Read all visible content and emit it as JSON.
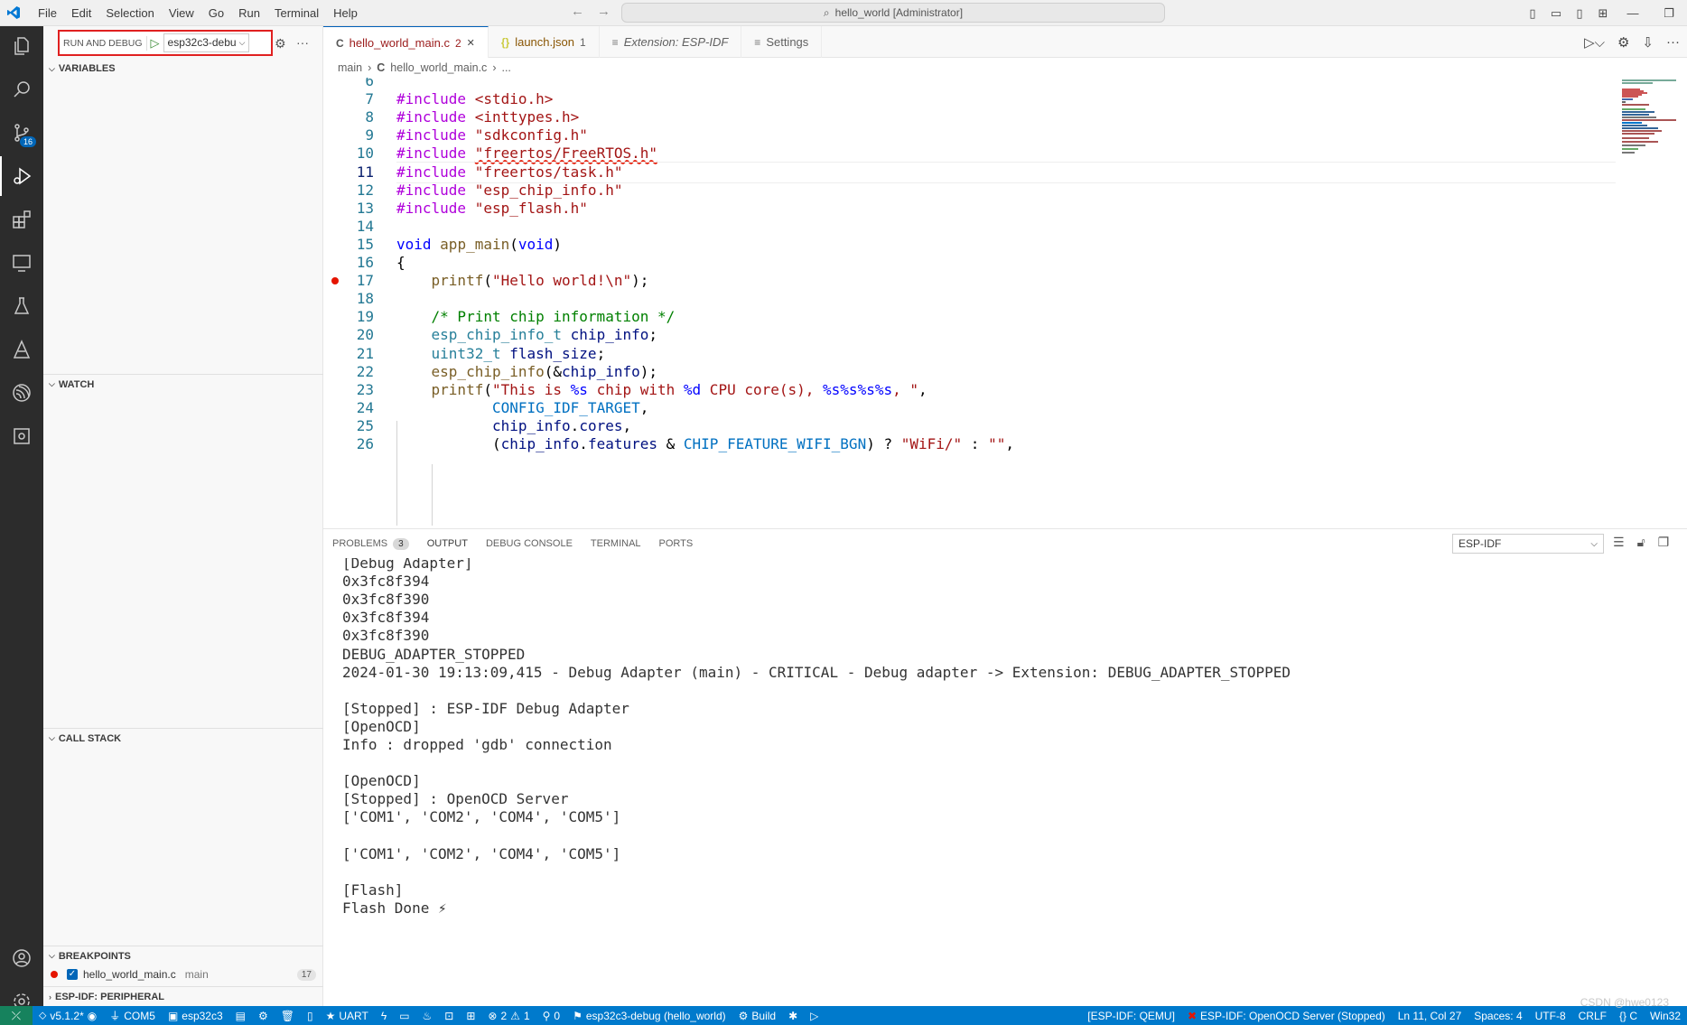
{
  "menu": [
    "File",
    "Edit",
    "Selection",
    "View",
    "Go",
    "Run",
    "Terminal",
    "Help"
  ],
  "command_center": "hello_world [Administrator]",
  "run_debug": {
    "label": "RUN AND DEBUG",
    "config": "esp32c3-debu"
  },
  "sections": {
    "variables": "VARIABLES",
    "watch": "WATCH",
    "call_stack": "CALL STACK",
    "breakpoints": "BREAKPOINTS",
    "peripheral": "ESP-IDF: PERIPHERAL"
  },
  "breakpoint": {
    "file": "hello_world_main.c",
    "function": "main",
    "line": "17"
  },
  "activity_badge": "16",
  "tabs": [
    {
      "icon": "C",
      "label": "hello_world_main.c",
      "count": "2"
    },
    {
      "icon": "{}",
      "label": "launch.json",
      "count": "1"
    },
    {
      "icon": "≡",
      "label": "Extension: ESP-IDF",
      "count": ""
    },
    {
      "icon": "≡",
      "label": "Settings",
      "count": ""
    }
  ],
  "breadcrumb": {
    "folder": "main",
    "file_icon": "C",
    "file": "hello_world_main.c",
    "more": "..."
  },
  "code": [
    {
      "n": "6",
      "t": []
    },
    {
      "n": "7",
      "t": [
        [
          "kw",
          "#include"
        ],
        [
          "plain",
          " "
        ],
        [
          "str",
          "<stdio.h>"
        ]
      ]
    },
    {
      "n": "8",
      "t": [
        [
          "kw",
          "#include"
        ],
        [
          "plain",
          " "
        ],
        [
          "str",
          "<inttypes.h>"
        ]
      ]
    },
    {
      "n": "9",
      "t": [
        [
          "kw",
          "#include"
        ],
        [
          "plain",
          " "
        ],
        [
          "str",
          "\"sdkconfig.h\""
        ]
      ]
    },
    {
      "n": "10",
      "t": [
        [
          "kw",
          "#include"
        ],
        [
          "plain",
          " "
        ],
        [
          "str",
          "\"freertos/FreeRTOS.h\""
        ]
      ]
    },
    {
      "n": "11",
      "t": [
        [
          "kw",
          "#include"
        ],
        [
          "plain",
          " "
        ],
        [
          "str",
          "\"freertos/task.h\""
        ]
      ]
    },
    {
      "n": "12",
      "t": [
        [
          "kw",
          "#include"
        ],
        [
          "plain",
          " "
        ],
        [
          "str",
          "\"esp_chip_info.h\""
        ]
      ]
    },
    {
      "n": "13",
      "t": [
        [
          "kw",
          "#include"
        ],
        [
          "plain",
          " "
        ],
        [
          "str",
          "\"esp_flash.h\""
        ]
      ]
    },
    {
      "n": "14",
      "t": []
    },
    {
      "n": "15",
      "t": [
        [
          "blu",
          "void"
        ],
        [
          "plain",
          " "
        ],
        [
          "fnc",
          "app_main"
        ],
        [
          "plain",
          "("
        ],
        [
          "blu",
          "void"
        ],
        [
          "plain",
          ")"
        ]
      ]
    },
    {
      "n": "16",
      "t": [
        [
          "plain",
          "{"
        ]
      ]
    },
    {
      "n": "17",
      "t": [
        [
          "plain",
          "    "
        ],
        [
          "fnc",
          "printf"
        ],
        [
          "plain",
          "("
        ],
        [
          "str",
          "\"Hello world!\\n\""
        ],
        [
          "plain",
          ");"
        ]
      ]
    },
    {
      "n": "18",
      "t": []
    },
    {
      "n": "19",
      "t": [
        [
          "plain",
          "    "
        ],
        [
          "cm",
          "/* Print chip information */"
        ]
      ]
    },
    {
      "n": "20",
      "t": [
        [
          "plain",
          "    "
        ],
        [
          "ty",
          "esp_chip_info_t"
        ],
        [
          "plain",
          " "
        ],
        [
          "var",
          "chip_info"
        ],
        [
          "plain",
          ";"
        ]
      ]
    },
    {
      "n": "21",
      "t": [
        [
          "plain",
          "    "
        ],
        [
          "ty",
          "uint32_t"
        ],
        [
          "plain",
          " "
        ],
        [
          "var",
          "flash_size"
        ],
        [
          "plain",
          ";"
        ]
      ]
    },
    {
      "n": "22",
      "t": [
        [
          "plain",
          "    "
        ],
        [
          "fnc",
          "esp_chip_info"
        ],
        [
          "plain",
          "(&"
        ],
        [
          "var",
          "chip_info"
        ],
        [
          "plain",
          ");"
        ]
      ]
    },
    {
      "n": "23",
      "t": [
        [
          "plain",
          "    "
        ],
        [
          "fnc",
          "printf"
        ],
        [
          "plain",
          "("
        ],
        [
          "str",
          "\"This is "
        ],
        [
          "blu",
          "%s"
        ],
        [
          "str",
          " chip with "
        ],
        [
          "blu",
          "%d"
        ],
        [
          "str",
          " CPU core(s), "
        ],
        [
          "blu",
          "%s%s%s%s"
        ],
        [
          "str",
          ", \""
        ],
        [
          "plain",
          ","
        ]
      ]
    },
    {
      "n": "24",
      "t": [
        [
          "plain",
          "           "
        ],
        [
          "mac",
          "CONFIG_IDF_TARGET"
        ],
        [
          "plain",
          ","
        ]
      ]
    },
    {
      "n": "25",
      "t": [
        [
          "plain",
          "           "
        ],
        [
          "var",
          "chip_info"
        ],
        [
          "plain",
          "."
        ],
        [
          "var",
          "cores"
        ],
        [
          "plain",
          ","
        ]
      ]
    },
    {
      "n": "26",
      "t": [
        [
          "plain",
          "           ("
        ],
        [
          "var",
          "chip_info"
        ],
        [
          "plain",
          "."
        ],
        [
          "var",
          "features"
        ],
        [
          "plain",
          " & "
        ],
        [
          "mac",
          "CHIP_FEATURE_WIFI_BGN"
        ],
        [
          "plain",
          ") ? "
        ],
        [
          "str",
          "\"WiFi/\""
        ],
        [
          "plain",
          " : "
        ],
        [
          "str",
          "\"\""
        ],
        [
          "plain",
          ","
        ]
      ]
    }
  ],
  "panel": {
    "tabs": [
      {
        "label": "PROBLEMS",
        "count": "3"
      },
      {
        "label": "OUTPUT",
        "count": ""
      },
      {
        "label": "DEBUG CONSOLE",
        "count": ""
      },
      {
        "label": "TERMINAL",
        "count": ""
      },
      {
        "label": "PORTS",
        "count": ""
      }
    ],
    "selected_channel": "ESP-IDF"
  },
  "output": [
    "[Debug Adapter]",
    "0x3fc8f394",
    "0x3fc8f390",
    "0x3fc8f394",
    "0x3fc8f390",
    "DEBUG_ADAPTER_STOPPED",
    "2024-01-30 19:13:09,415 - Debug Adapter (main) - CRITICAL - Debug adapter -> Extension: DEBUG_ADAPTER_STOPPED",
    "",
    "[Stopped] : ESP-IDF Debug Adapter",
    "[OpenOCD]",
    "Info : dropped 'gdb' connection",
    "",
    "[OpenOCD]",
    "[Stopped] : OpenOCD Server",
    "['COM1', 'COM2', 'COM4', 'COM5']",
    "",
    "['COM1', 'COM2', 'COM4', 'COM5']",
    "",
    "[Flash]",
    "Flash Done ⚡"
  ],
  "status": {
    "version": "v5.1.2*",
    "port": "COM5",
    "target": "esp32c3",
    "uart": "UART",
    "errors": "2",
    "warnings": "1",
    "ports_count": "0",
    "debug_config": "esp32c3-debug (hello_world)",
    "build": "Build",
    "qemu": "[ESP-IDF: QEMU]",
    "openocd": "ESP-IDF: OpenOCD Server (Stopped)",
    "cursor": "Ln 11, Col 27",
    "spaces": "Spaces: 4",
    "encoding": "UTF-8",
    "eol": "CRLF",
    "lang": "{} C",
    "platform": "Win32"
  },
  "watermark": "CSDN @hwe0123",
  "colors": {
    "accent": "#007acc",
    "breakpoint": "#e51400",
    "highlight_border": "#e02020"
  }
}
